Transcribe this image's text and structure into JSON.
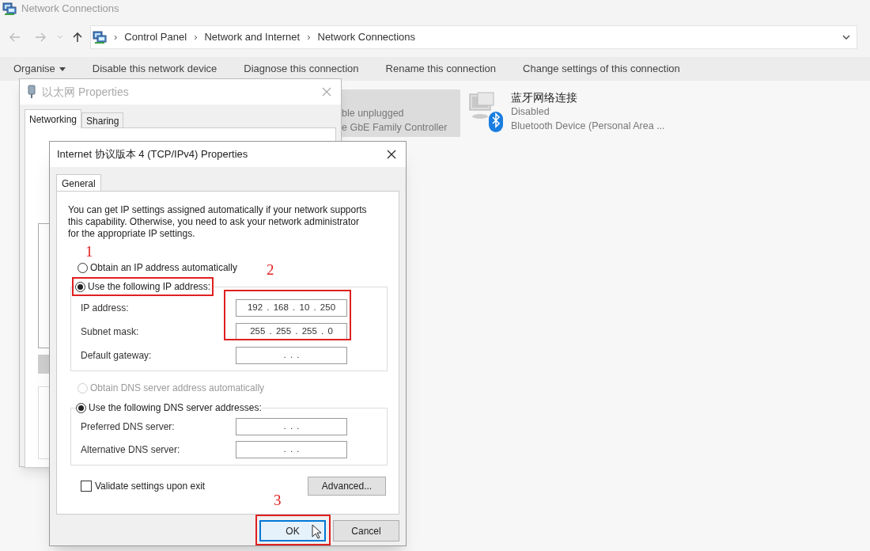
{
  "explorer": {
    "title": "Network Connections",
    "breadcrumb": [
      {
        "separator": "›",
        "label": "Control Panel"
      },
      {
        "separator": "›",
        "label": "Network and Internet"
      },
      {
        "separator": "›",
        "label": "Network Connections"
      }
    ],
    "toolbar": [
      {
        "label": "Organise",
        "dropdown": true
      },
      {
        "label": "Disable this network device",
        "dropdown": false
      },
      {
        "label": "Diagnose this connection",
        "dropdown": false
      },
      {
        "label": "Rename this connection",
        "dropdown": false
      },
      {
        "label": "Change settings of this connection",
        "dropdown": false
      }
    ],
    "connections": [
      {
        "kind": "ethernet",
        "selected": true,
        "lines": [
          "ble unplugged",
          "e GbE Family Controller"
        ]
      },
      {
        "kind": "bluetooth",
        "selected": false,
        "name": "蓝牙网络连接",
        "lines": [
          "Disabled",
          "Bluetooth Device (Personal Area ..."
        ]
      }
    ]
  },
  "properties_dialog": {
    "title": "以太网 Properties",
    "tabs": [
      {
        "label": "Networking",
        "selected": true
      },
      {
        "label": "Sharing",
        "selected": false
      }
    ]
  },
  "ipv4_dialog": {
    "title": "Internet 协议版本 4 (TCP/IPv4) Properties",
    "tabs": [
      {
        "label": "General",
        "selected": true
      }
    ],
    "description": "You can get IP settings assigned automatically if your network supports this capability. Otherwise, you need to ask your network administrator for the appropriate IP settings.",
    "ip_modes": [
      {
        "label": "Obtain an IP address automatically",
        "selected": false,
        "disabled": false
      },
      {
        "label": "Use the following IP address:",
        "selected": true,
        "disabled": false
      }
    ],
    "ip_fields": [
      {
        "label": "IP address:",
        "value": "192 . 168 . 10 . 250"
      },
      {
        "label": "Subnet mask:",
        "value": "255 . 255 . 255 . 0"
      },
      {
        "label": "Default gateway:",
        "value": ". . ."
      }
    ],
    "dns_modes": [
      {
        "label": "Obtain DNS server address automatically",
        "selected": false,
        "disabled": true
      },
      {
        "label": "Use the following DNS server addresses:",
        "selected": true,
        "disabled": false
      }
    ],
    "dns_fields": [
      {
        "label": "Preferred DNS server:",
        "value": ". . ."
      },
      {
        "label": "Alternative DNS server:",
        "value": ". . ."
      }
    ],
    "validate": {
      "label": "Validate settings upon exit",
      "checked": false
    },
    "advanced_button": "Advanced...",
    "buttons": [
      {
        "label": "OK",
        "focused": true
      },
      {
        "label": "Cancel",
        "focused": false
      }
    ]
  },
  "annotations": [
    {
      "label": "1"
    },
    {
      "label": "2"
    },
    {
      "label": "3"
    }
  ]
}
